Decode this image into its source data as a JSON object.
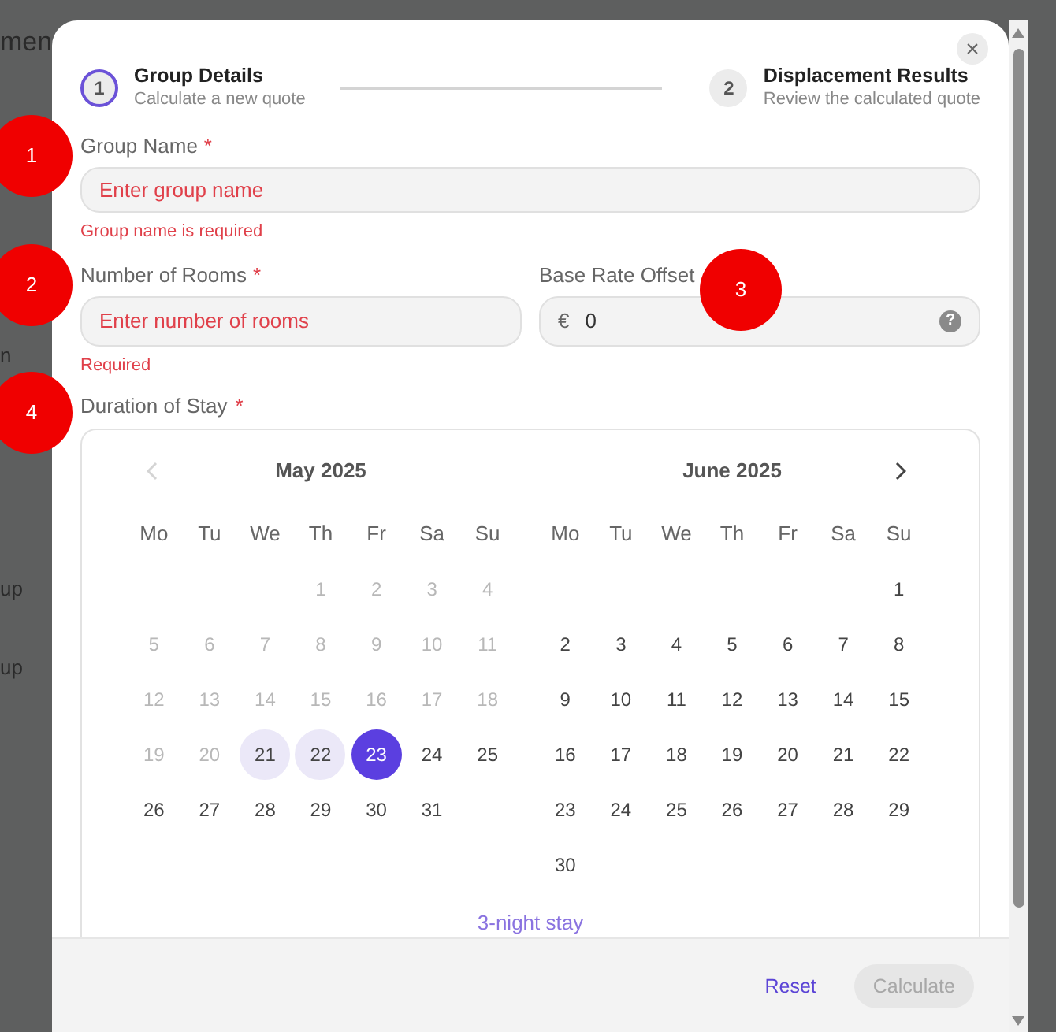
{
  "background": {
    "fragments": [
      "men",
      "n",
      "up",
      "up"
    ]
  },
  "dialog": {
    "close": "×",
    "steps": [
      {
        "number": "1",
        "title": "Group Details",
        "subtitle": "Calculate a new quote",
        "selected": true
      },
      {
        "number": "2",
        "title": "Displacement Results",
        "subtitle": "Review the calculated quote",
        "selected": false
      }
    ],
    "group_name": {
      "label": "Group Name",
      "required": "*",
      "placeholder": "Enter group name",
      "error": "Group name is required"
    },
    "rooms": {
      "label": "Number of Rooms",
      "required": "*",
      "placeholder": "Enter number of rooms",
      "error": "Required"
    },
    "offset": {
      "label": "Base Rate Offset",
      "prefix": "€",
      "value": "0",
      "help": "?"
    },
    "duration": {
      "label": "Duration of Stay",
      "required": "*"
    },
    "calendar": {
      "prev_disabled": true,
      "months": [
        {
          "title": "May 2025",
          "weekdays": [
            "Mo",
            "Tu",
            "We",
            "Th",
            "Fr",
            "Sa",
            "Su"
          ],
          "weeks": [
            [
              {
                "label": "1",
                "disabled": true,
                "in_range": false,
                "selected": false
              },
              {
                "label": "2",
                "disabled": true,
                "in_range": false,
                "selected": false
              },
              {
                "label": "3",
                "disabled": true,
                "in_range": false,
                "selected": false
              },
              {
                "label": "4",
                "disabled": true,
                "in_range": false,
                "selected": false
              }
            ],
            [
              {
                "label": "5",
                "disabled": true,
                "in_range": false,
                "selected": false
              },
              {
                "label": "6",
                "disabled": true,
                "in_range": false,
                "selected": false
              },
              {
                "label": "7",
                "disabled": true,
                "in_range": false,
                "selected": false
              },
              {
                "label": "8",
                "disabled": true,
                "in_range": false,
                "selected": false
              },
              {
                "label": "9",
                "disabled": true,
                "in_range": false,
                "selected": false
              },
              {
                "label": "10",
                "disabled": true,
                "in_range": false,
                "selected": false
              },
              {
                "label": "11",
                "disabled": true,
                "in_range": false,
                "selected": false
              }
            ],
            [
              {
                "label": "12",
                "disabled": true,
                "in_range": false,
                "selected": false
              },
              {
                "label": "13",
                "disabled": true,
                "in_range": false,
                "selected": false
              },
              {
                "label": "14",
                "disabled": true,
                "in_range": false,
                "selected": false
              },
              {
                "label": "15",
                "disabled": true,
                "in_range": false,
                "selected": false
              },
              {
                "label": "16",
                "disabled": true,
                "in_range": false,
                "selected": false
              },
              {
                "label": "17",
                "disabled": true,
                "in_range": false,
                "selected": false
              },
              {
                "label": "18",
                "disabled": true,
                "in_range": false,
                "selected": false
              }
            ],
            [
              {
                "label": "19",
                "disabled": true,
                "in_range": false,
                "selected": false
              },
              {
                "label": "20",
                "disabled": true,
                "in_range": false,
                "selected": false
              },
              {
                "label": "21",
                "disabled": false,
                "in_range": true,
                "selected": false
              },
              {
                "label": "22",
                "disabled": false,
                "in_range": true,
                "selected": false
              },
              {
                "label": "23",
                "disabled": false,
                "in_range": false,
                "selected": true
              },
              {
                "label": "24",
                "disabled": false,
                "in_range": false,
                "selected": false
              },
              {
                "label": "25",
                "disabled": false,
                "in_range": false,
                "selected": false
              }
            ],
            [
              {
                "label": "26",
                "disabled": false,
                "in_range": false,
                "selected": false
              },
              {
                "label": "27",
                "disabled": false,
                "in_range": false,
                "selected": false
              },
              {
                "label": "28",
                "disabled": false,
                "in_range": false,
                "selected": false
              },
              {
                "label": "29",
                "disabled": false,
                "in_range": false,
                "selected": false
              },
              {
                "label": "30",
                "disabled": false,
                "in_range": false,
                "selected": false
              },
              {
                "label": "31",
                "disabled": false,
                "in_range": false,
                "selected": false
              }
            ]
          ]
        },
        {
          "title": "June 2025",
          "weekdays": [
            "Mo",
            "Tu",
            "We",
            "Th",
            "Fr",
            "Sa",
            "Su"
          ],
          "weeks": [
            [
              {
                "label": "1",
                "disabled": false,
                "in_range": false,
                "selected": false
              }
            ],
            [
              {
                "label": "2",
                "disabled": false,
                "in_range": false,
                "selected": false
              },
              {
                "label": "3",
                "disabled": false,
                "in_range": false,
                "selected": false
              },
              {
                "label": "4",
                "disabled": false,
                "in_range": false,
                "selected": false
              },
              {
                "label": "5",
                "disabled": false,
                "in_range": false,
                "selected": false
              },
              {
                "label": "6",
                "disabled": false,
                "in_range": false,
                "selected": false
              },
              {
                "label": "7",
                "disabled": false,
                "in_range": false,
                "selected": false
              },
              {
                "label": "8",
                "disabled": false,
                "in_range": false,
                "selected": false
              }
            ],
            [
              {
                "label": "9",
                "disabled": false,
                "in_range": false,
                "selected": false
              },
              {
                "label": "10",
                "disabled": false,
                "in_range": false,
                "selected": false
              },
              {
                "label": "11",
                "disabled": false,
                "in_range": false,
                "selected": false
              },
              {
                "label": "12",
                "disabled": false,
                "in_range": false,
                "selected": false
              },
              {
                "label": "13",
                "disabled": false,
                "in_range": false,
                "selected": false
              },
              {
                "label": "14",
                "disabled": false,
                "in_range": false,
                "selected": false
              },
              {
                "label": "15",
                "disabled": false,
                "in_range": false,
                "selected": false
              }
            ],
            [
              {
                "label": "16",
                "disabled": false,
                "in_range": false,
                "selected": false
              },
              {
                "label": "17",
                "disabled": false,
                "in_range": false,
                "selected": false
              },
              {
                "label": "18",
                "disabled": false,
                "in_range": false,
                "selected": false
              },
              {
                "label": "19",
                "disabled": false,
                "in_range": false,
                "selected": false
              },
              {
                "label": "20",
                "disabled": false,
                "in_range": false,
                "selected": false
              },
              {
                "label": "21",
                "disabled": false,
                "in_range": false,
                "selected": false
              },
              {
                "label": "22",
                "disabled": false,
                "in_range": false,
                "selected": false
              }
            ],
            [
              {
                "label": "23",
                "disabled": false,
                "in_range": false,
                "selected": false
              },
              {
                "label": "24",
                "disabled": false,
                "in_range": false,
                "selected": false
              },
              {
                "label": "25",
                "disabled": false,
                "in_range": false,
                "selected": false
              },
              {
                "label": "26",
                "disabled": false,
                "in_range": false,
                "selected": false
              },
              {
                "label": "27",
                "disabled": false,
                "in_range": false,
                "selected": false
              },
              {
                "label": "28",
                "disabled": false,
                "in_range": false,
                "selected": false
              },
              {
                "label": "29",
                "disabled": false,
                "in_range": false,
                "selected": false
              }
            ],
            [
              {
                "label": "30",
                "disabled": false,
                "in_range": false,
                "selected": false
              }
            ]
          ]
        }
      ],
      "summary": "3-night stay"
    },
    "buttons": [
      {
        "label": "Reset",
        "disabled": false
      },
      {
        "label": "Calculate",
        "disabled": true
      }
    ]
  },
  "annotations": [
    "1",
    "2",
    "3",
    "4"
  ]
}
